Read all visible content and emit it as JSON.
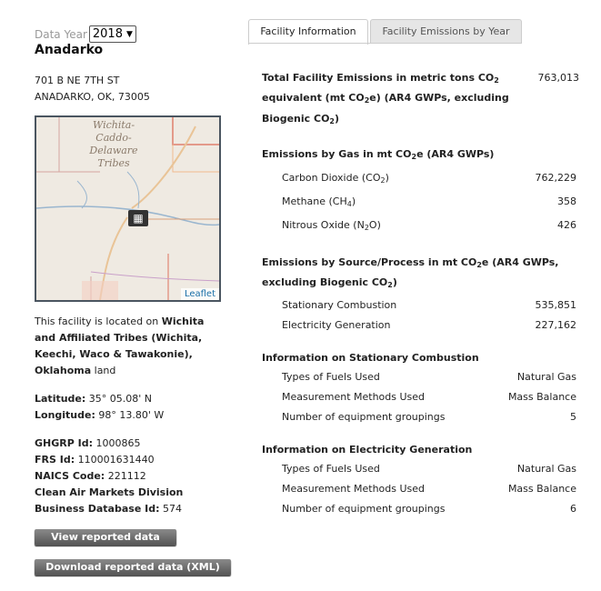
{
  "data_year": {
    "label": "Data Year",
    "selected": "2018"
  },
  "facility": {
    "name": "Anadarko",
    "address1": "701 B NE 7TH ST",
    "address2": "ANADARKO, OK, 73005",
    "location_prefix": "This facility is located on ",
    "location_name": "Wichita and Affiliated Tribes (Wichita, Keechi, Waco & Tawakonie), Oklahoma",
    "location_suffix": " land",
    "latitude_label": "Latitude:",
    "latitude": "35° 05.08' N",
    "longitude_label": "Longitude:",
    "longitude": "98° 13.80' W",
    "ghgrp_label": "GHGRP Id:",
    "ghgrp": "1000865",
    "frs_label": "FRS Id:",
    "frs": "110001631440",
    "naics_label": "NAICS Code:",
    "naics": "221112",
    "camd_label": "Clean Air Markets Division Business Database Id:",
    "camd": "574"
  },
  "map": {
    "region_label": "Wichita-Caddo-Delaware Tribes",
    "attribution": "Leaflet"
  },
  "buttons": {
    "view": "View reported data",
    "download": "Download reported data (XML)"
  },
  "tabs": [
    {
      "label": "Facility Information"
    },
    {
      "label": "Facility Emissions by Year"
    }
  ],
  "total": {
    "label_a": "Total Facility Emissions in metric tons CO",
    "label_b": "equivalent (mt CO",
    "label_c": "e) (AR4 GWPs, excluding",
    "label_d": "Biogenic CO",
    "value": "763,013"
  },
  "by_gas": {
    "heading_a": "Emissions by Gas in mt CO",
    "heading_b": "e (AR4 GWPs)",
    "rows": [
      {
        "label_a": "Carbon Dioxide (CO",
        "sub": "2",
        "label_b": ")",
        "value": "762,229"
      },
      {
        "label_a": "Methane (CH",
        "sub": "4",
        "label_b": ")",
        "value": "358"
      },
      {
        "label_a": "Nitrous Oxide (N",
        "sub": "2",
        "label_b": "O)",
        "value": "426"
      }
    ]
  },
  "by_source": {
    "heading_a": "Emissions by Source/Process in mt CO",
    "heading_b": "e (AR4 GWPs,",
    "heading_c": "excluding Biogenic CO",
    "rows": [
      {
        "label": "Stationary Combustion",
        "value": "535,851"
      },
      {
        "label": "Electricity Generation",
        "value": "227,162"
      }
    ]
  },
  "stationary": {
    "heading": "Information on Stationary Combustion",
    "rows": [
      {
        "label": "Types of Fuels Used",
        "value": "Natural Gas"
      },
      {
        "label": "Measurement Methods Used",
        "value": "Mass Balance"
      },
      {
        "label": "Number of equipment groupings",
        "value": "5"
      }
    ]
  },
  "electricity": {
    "heading": "Information on Electricity Generation",
    "rows": [
      {
        "label": "Types of Fuels Used",
        "value": "Natural Gas"
      },
      {
        "label": "Measurement Methods Used",
        "value": "Mass Balance"
      },
      {
        "label": "Number of equipment groupings",
        "value": "6"
      }
    ]
  },
  "sub2": "2",
  "colors": {
    "tab_active_bg": "#ffffff",
    "tab_inactive_bg": "#e6e6e6",
    "button_bg": "#666666",
    "map_border": "#4a5560",
    "link": "#1a6fa8"
  }
}
